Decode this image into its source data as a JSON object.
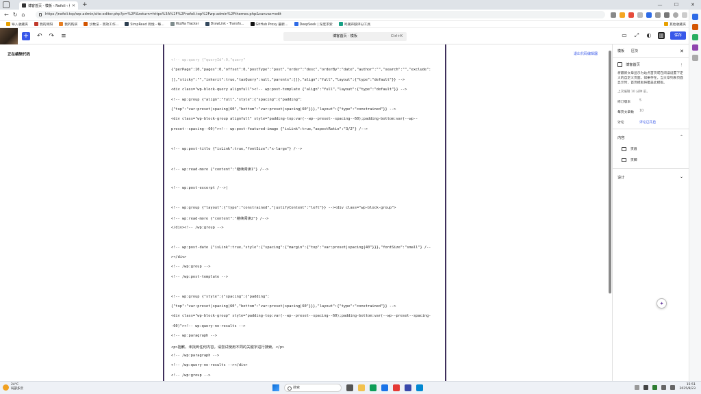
{
  "browser": {
    "tab_title": "博客首页 - 模板 ‹ Nefeli ‹ 编辑器",
    "url": "https://nefeli.top/wp-admin/site-editor.php?p=%2Fl&return=https%3A%2F%2Fnefeli.top%2Fwp-admin%2Fthemes.php&canvas=edit",
    "bookmarks": [
      {
        "label": "导入收藏夹",
        "color": "#e8a000"
      },
      {
        "label": "我的简阳",
        "color": "#c0392b"
      },
      {
        "label": "我的购买",
        "color": "#e67e22"
      },
      {
        "label": "沙数法 - 高效工作...",
        "color": "#d35400"
      },
      {
        "label": "SimpRead 简悦 - 每...",
        "color": "#2c3e50"
      },
      {
        "label": "WuWa Tracker",
        "color": "#7f8c8d"
      },
      {
        "label": "DrawLink - Transfo...",
        "color": "#34495e"
      },
      {
        "label": "GitHub Proxy 最新...",
        "color": "#111111"
      },
      {
        "label": "DeepSeek | 深度求索",
        "color": "#2e6be6"
      },
      {
        "label": "鸣潮声骸评分工具",
        "color": "#16a085"
      }
    ],
    "other_bookmarks": "其他收藏夹"
  },
  "editor": {
    "command_bar_title": "博客首页 · 模板",
    "command_bar_shortcut": "Ctrl+K",
    "save_label": "保存",
    "left_panel_title": "正在编辑代码",
    "exit_code_editor": "退出代码编辑器",
    "code_lines": [
      {
        "text": "<!-- wp:query {\"queryId\":0,\"query\"",
        "faded": true
      },
      {
        "text": "{\"perPage\":10,\"pages\":0,\"offset\":0,\"postType\":\"post\",\"order\":\"desc\",\"orderBy\":\"date\",\"author\":\"\",\"search\":\"\",\"exclude\":",
        "faded": false
      },
      {
        "text": "[],\"sticky\":\"\",\"inherit\":true,\"taxQuery\":null,\"parents\":[]},\"align\":\"full\",\"layout\":{\"type\":\"default\"}} -->",
        "faded": false
      },
      {
        "text": "<div class=\"wp-block-query alignfull\"><!-- wp:post-template {\"align\":\"full\",\"layout\":{\"type\":\"default\"}} -->",
        "faded": false
      },
      {
        "text": "<!-- wp:group {\"align\":\"full\",\"style\":{\"spacing\":{\"padding\":",
        "faded": false
      },
      {
        "text": "{\"top\":\"var:preset|spacing|60\",\"bottom\":\"var:preset|spacing|60\"}}},\"layout\":{\"type\":\"constrained\"}} -->",
        "faded": false
      },
      {
        "text": "<div class=\"wp-block-group alignfull\" style=\"padding-top:var(--wp--preset--spacing--60);padding-bottom:var(--wp--",
        "faded": false
      },
      {
        "text": "preset--spacing--60)\"><!-- wp:post-featured-image {\"isLink\":true,\"aspectRatio\":\"3/2\"} /-->",
        "faded": false
      },
      {
        "text": "",
        "faded": false
      },
      {
        "text": "<!-- wp:post-title {\"isLink\":true,\"fontSize\":\"x-large\"} /-->",
        "faded": false
      },
      {
        "text": "",
        "faded": false
      },
      {
        "text": "<!-- wp:read-more {\"content\":\"继续阅读1\"} /-->",
        "faded": false
      },
      {
        "text": "",
        "faded": false
      },
      {
        "text": "<!-- wp:post-excerpt /-->|",
        "faded": false
      },
      {
        "text": "",
        "faded": false
      },
      {
        "text": "<!-- wp:group {\"layout\":{\"type\":\"constrained\",\"justifyContent\":\"left\"}} --><div class=\"wp-block-group\">",
        "faded": false
      },
      {
        "text": "<!-- wp:read-more {\"content\":\"继续阅读2\"} /-->",
        "faded": false
      },
      {
        "text": "</div><!-- /wp:group -->",
        "faded": false
      },
      {
        "text": "",
        "faded": false
      },
      {
        "text": "<!-- wp:post-date {\"isLink\":true,\"style\":{\"spacing\":{\"margin\":{\"top\":\"var:preset|spacing|40\"}}},\"fontSize\":\"small\"} /--",
        "faded": false
      },
      {
        "text": "></div>",
        "faded": false
      },
      {
        "text": "<!-- /wp:group -->",
        "faded": false
      },
      {
        "text": "<!-- /wp:post-template -->",
        "faded": false
      },
      {
        "text": "",
        "faded": false
      },
      {
        "text": "<!-- wp:group {\"style\":{\"spacing\":{\"padding\":",
        "faded": false
      },
      {
        "text": "{\"top\":\"var:preset|spacing|60\",\"bottom\":\"var:preset|spacing|60\"}}},\"layout\":{\"type\":\"constrained\"}} -->",
        "faded": false
      },
      {
        "text": "<div class=\"wp-block-group\" style=\"padding-top:var(--wp--preset--spacing--60);padding-bottom:var(--wp--preset--spacing-",
        "faded": false
      },
      {
        "text": "-60)\"><!-- wp:query-no-results -->",
        "faded": false
      },
      {
        "text": "<!-- wp:paragraph -->",
        "faded": false
      },
      {
        "text": "<p>抱歉，未找到任何内容。请尝试使用不同的关键字进行搜索。</p>",
        "faded": false
      },
      {
        "text": "<!-- /wp:paragraph -->",
        "faded": false
      },
      {
        "text": "<!-- /wp:query-no-results --></div>",
        "faded": false
      },
      {
        "text": "<!-- /wp:group -->",
        "faded": false
      }
    ]
  },
  "inspector": {
    "tab_template": "模板",
    "tab_block": "区块",
    "template_name": "博客首页",
    "description": "将最新文章显示为站点首页或在阅读设置下定义的自定义页面。如果存在，当文章列表页面显示时，首页模板将覆盖此模板。",
    "last_edited": "上次编辑 10 分钟 前。",
    "rows": [
      {
        "key": "修订版本",
        "value": "5",
        "link": false
      },
      {
        "key": "每页文章数",
        "value": "10",
        "link": false
      },
      {
        "key": "讨论",
        "value": "评论已开启",
        "link": true
      }
    ],
    "content_label": "内容",
    "content_items": [
      "页眉",
      "页脚"
    ],
    "design_label": "设计"
  },
  "taskbar": {
    "temperature": "24°C",
    "weather": "局部多云",
    "search_placeholder": "搜索",
    "time": "15:51",
    "date": "2025/8/23"
  },
  "colors": {
    "accent": "#3858e9",
    "frame_border": "#3e2f5b"
  }
}
